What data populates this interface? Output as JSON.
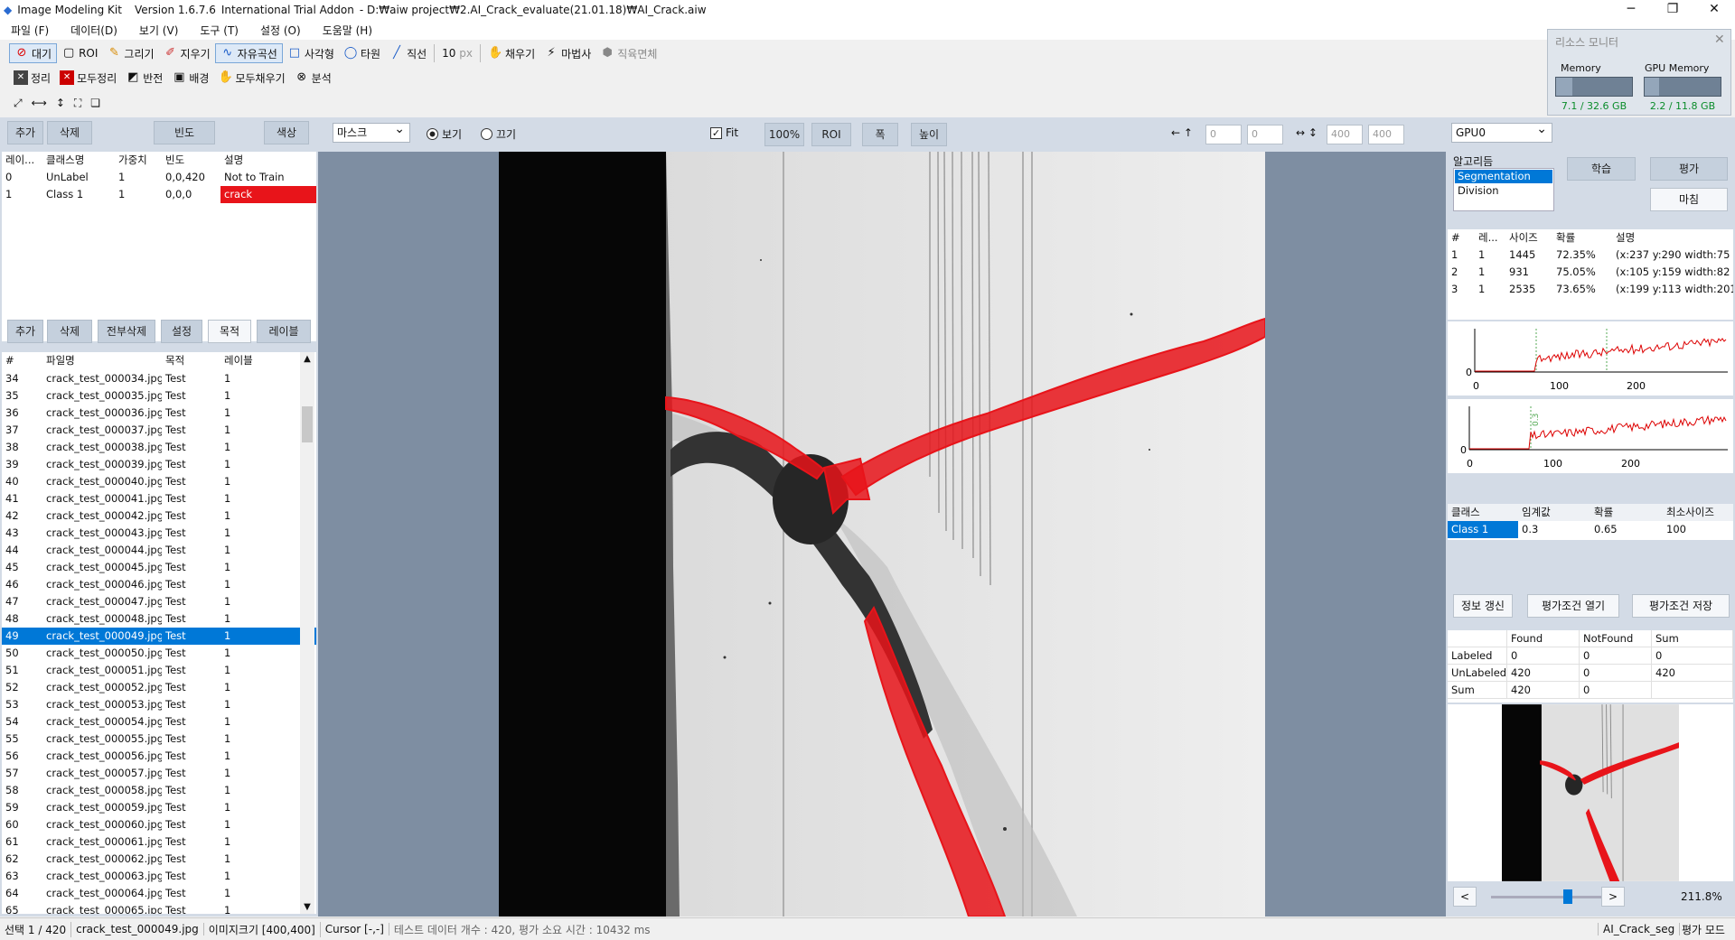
{
  "title": {
    "app_name": "Image Modeling Kit",
    "version": "Version 1.6.7.6",
    "edition": "International Trial Addon",
    "path": "- D:₩aiw project₩2.AI_Crack_evaluate(21.01.18)₩AI_Crack.aiw"
  },
  "menu": [
    "파일 (F)",
    "데이터(D)",
    "보기 (V)",
    "도구 (T)",
    "설정 (O)",
    "도움말 (H)"
  ],
  "toolbar1": {
    "wait": "대기",
    "roi": "ROI",
    "draw": "그리기",
    "erase": "지우기",
    "freecurve": "자유곡선",
    "rect": "사각형",
    "ellipse": "타원",
    "line": "직선",
    "size": "10",
    "unit": "px",
    "fill": "채우기",
    "magic": "마법사",
    "rect_area": "직육면체"
  },
  "toolbar2": {
    "clean": "정리",
    "clean_all": "모두정리",
    "invert": "반전",
    "background": "배경",
    "fill_all": "모두채우기",
    "analyze": "분석"
  },
  "resource": {
    "title": "리소스 모니터",
    "memory_label": "Memory",
    "gpu_label": "GPU Memory",
    "memory_value": "7.1 / 32.6 GB",
    "gpu_value": "2.2 / 11.8 GB",
    "memory_fraction": 0.22,
    "gpu_fraction": 0.19
  },
  "class_panel": {
    "add": "추가",
    "delete": "삭제",
    "freq": "빈도",
    "color": "색상",
    "headers": [
      "레이...",
      "클래스명",
      "가중치",
      "빈도",
      "설명"
    ],
    "rows": [
      {
        "id": "0",
        "name": "UnLabel",
        "weight": "1",
        "freq": "0,0,420",
        "desc": "Not to Train"
      },
      {
        "id": "1",
        "name": "Class 1",
        "weight": "1",
        "freq": "0,0,0",
        "desc": "crack"
      }
    ]
  },
  "file_panel": {
    "add": "추가",
    "delete": "삭제",
    "delete_all": "전부삭제",
    "setting": "설정",
    "purpose": "목적",
    "label": "레이블",
    "headers": [
      "#",
      "파일명",
      "목적",
      "레이블"
    ],
    "rows": [
      [
        "34",
        "crack_test_000034.jpg",
        "Test",
        "1"
      ],
      [
        "35",
        "crack_test_000035.jpg",
        "Test",
        "1"
      ],
      [
        "36",
        "crack_test_000036.jpg",
        "Test",
        "1"
      ],
      [
        "37",
        "crack_test_000037.jpg",
        "Test",
        "1"
      ],
      [
        "38",
        "crack_test_000038.jpg",
        "Test",
        "1"
      ],
      [
        "39",
        "crack_test_000039.jpg",
        "Test",
        "1"
      ],
      [
        "40",
        "crack_test_000040.jpg",
        "Test",
        "1"
      ],
      [
        "41",
        "crack_test_000041.jpg",
        "Test",
        "1"
      ],
      [
        "42",
        "crack_test_000042.jpg",
        "Test",
        "1"
      ],
      [
        "43",
        "crack_test_000043.jpg",
        "Test",
        "1"
      ],
      [
        "44",
        "crack_test_000044.jpg",
        "Test",
        "1"
      ],
      [
        "45",
        "crack_test_000045.jpg",
        "Test",
        "1"
      ],
      [
        "46",
        "crack_test_000046.jpg",
        "Test",
        "1"
      ],
      [
        "47",
        "crack_test_000047.jpg",
        "Test",
        "1"
      ],
      [
        "48",
        "crack_test_000048.jpg",
        "Test",
        "1"
      ],
      [
        "49",
        "crack_test_000049.jpg",
        "Test",
        "1"
      ],
      [
        "50",
        "crack_test_000050.jpg",
        "Test",
        "1"
      ],
      [
        "51",
        "crack_test_000051.jpg",
        "Test",
        "1"
      ],
      [
        "52",
        "crack_test_000052.jpg",
        "Test",
        "1"
      ],
      [
        "53",
        "crack_test_000053.jpg",
        "Test",
        "1"
      ],
      [
        "54",
        "crack_test_000054.jpg",
        "Test",
        "1"
      ],
      [
        "55",
        "crack_test_000055.jpg",
        "Test",
        "1"
      ],
      [
        "56",
        "crack_test_000056.jpg",
        "Test",
        "1"
      ],
      [
        "57",
        "crack_test_000057.jpg",
        "Test",
        "1"
      ],
      [
        "58",
        "crack_test_000058.jpg",
        "Test",
        "1"
      ],
      [
        "59",
        "crack_test_000059.jpg",
        "Test",
        "1"
      ],
      [
        "60",
        "crack_test_000060.jpg",
        "Test",
        "1"
      ],
      [
        "61",
        "crack_test_000061.jpg",
        "Test",
        "1"
      ],
      [
        "62",
        "crack_test_000062.jpg",
        "Test",
        "1"
      ],
      [
        "63",
        "crack_test_000063.jpg",
        "Test",
        "1"
      ],
      [
        "64",
        "crack_test_000064.jpg",
        "Test",
        "1"
      ],
      [
        "65",
        "crack_test_000065.jpg",
        "Test",
        "1"
      ]
    ],
    "selected": "49"
  },
  "view": {
    "mask_select": "마스크",
    "show": "보기",
    "hide": "끄기",
    "fit": "Fit",
    "zoom100": "100%",
    "roi": "ROI",
    "width": "폭",
    "height": "높이",
    "x": "0",
    "y": "0",
    "w": "400",
    "h": "400"
  },
  "right": {
    "gpu": "GPU0",
    "algorithms_label": "알고리듬",
    "algorithms": [
      "Segmentation",
      "Division"
    ],
    "train": "학습",
    "evaluate": "평가",
    "finish": "마침",
    "results_headers": [
      "#",
      "레...",
      "사이즈",
      "확률",
      "설명"
    ],
    "results": [
      [
        "1",
        "1",
        "1445",
        "72.35%",
        "(x:237 y:290 width:75 ..."
      ],
      [
        "2",
        "1",
        "931",
        "75.05%",
        "(x:105 y:159 width:82 ..."
      ],
      [
        "3",
        "1",
        "2535",
        "73.65%",
        "(x:199 y:113 width:201..."
      ]
    ],
    "chart1_ticks": [
      "0",
      "100",
      "200"
    ],
    "chart1_y0": "0",
    "chart2_ticks": [
      "0",
      "100",
      "200"
    ],
    "chart2_y0": "0",
    "chart2_marker": "0.3",
    "params_headers": [
      "클래스",
      "임계값",
      "확률",
      "최소사이즈"
    ],
    "params_row": [
      "Class 1",
      "0.3",
      "0.65",
      "100"
    ],
    "refresh": "정보 갱신",
    "open_cond": "평가조건 열기",
    "save_cond": "평가조건 저장",
    "stats_headers": [
      "",
      "Found",
      "NotFound",
      "Sum"
    ],
    "stats": [
      [
        "Labeled",
        "0",
        "0",
        "0"
      ],
      [
        "UnLabeled",
        "420",
        "0",
        "420"
      ],
      [
        "Sum",
        "420",
        "0",
        ""
      ]
    ],
    "zoom": "211.8%",
    "prev": "<",
    "next": ">"
  },
  "status": {
    "selection": "선택 1 / 420",
    "file": "crack_test_000049.jpg",
    "imgsize": "이미지크기 [400,400]",
    "cursor": "Cursor [-,-]",
    "info": "테스트 데이터 개수 : 420,   평가 소요 시간 : 10432 ms",
    "model": "AI_Crack_seg",
    "mode": "평가 모드"
  },
  "colors": {
    "crack": "#e8141a",
    "selection": "#0078d7",
    "panel": "#d3dbe6",
    "canvas_bg": "#7e8ea2"
  }
}
